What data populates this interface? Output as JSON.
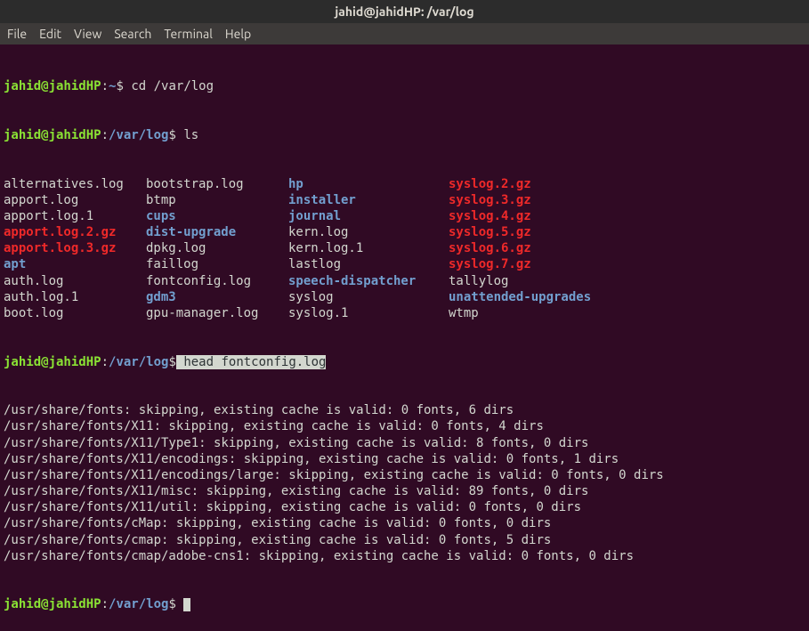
{
  "title_bar": "jahid@jahidHP: /var/log",
  "menu": {
    "file": "File",
    "edit": "Edit",
    "view": "View",
    "search": "Search",
    "terminal": "Terminal",
    "help": "Help"
  },
  "prompts": {
    "user_host": "jahid@jahidHP",
    "home_path": "~",
    "log_path": "/var/log",
    "dollar": "$"
  },
  "commands": {
    "cd": " cd /var/log",
    "ls": " ls",
    "head": " head fontconfig.log"
  },
  "ls": {
    "rows": [
      [
        {
          "t": "alternatives.log",
          "c": "white"
        },
        {
          "t": "bootstrap.log",
          "c": "white"
        },
        {
          "t": "hp",
          "c": "blue"
        },
        {
          "t": "syslog.2.gz",
          "c": "red"
        }
      ],
      [
        {
          "t": "apport.log",
          "c": "white"
        },
        {
          "t": "btmp",
          "c": "white"
        },
        {
          "t": "installer",
          "c": "blue"
        },
        {
          "t": "syslog.3.gz",
          "c": "red"
        }
      ],
      [
        {
          "t": "apport.log.1",
          "c": "white"
        },
        {
          "t": "cups",
          "c": "blue"
        },
        {
          "t": "journal",
          "c": "blue"
        },
        {
          "t": "syslog.4.gz",
          "c": "red"
        }
      ],
      [
        {
          "t": "apport.log.2.gz",
          "c": "red"
        },
        {
          "t": "dist-upgrade",
          "c": "blue"
        },
        {
          "t": "kern.log",
          "c": "white"
        },
        {
          "t": "syslog.5.gz",
          "c": "red"
        }
      ],
      [
        {
          "t": "apport.log.3.gz",
          "c": "red"
        },
        {
          "t": "dpkg.log",
          "c": "white"
        },
        {
          "t": "kern.log.1",
          "c": "white"
        },
        {
          "t": "syslog.6.gz",
          "c": "red"
        }
      ],
      [
        {
          "t": "apt",
          "c": "blue"
        },
        {
          "t": "faillog",
          "c": "white"
        },
        {
          "t": "lastlog",
          "c": "white"
        },
        {
          "t": "syslog.7.gz",
          "c": "red"
        }
      ],
      [
        {
          "t": "auth.log",
          "c": "white"
        },
        {
          "t": "fontconfig.log",
          "c": "white"
        },
        {
          "t": "speech-dispatcher",
          "c": "blue"
        },
        {
          "t": "tallylog",
          "c": "white"
        }
      ],
      [
        {
          "t": "auth.log.1",
          "c": "white"
        },
        {
          "t": "gdm3",
          "c": "blue"
        },
        {
          "t": "syslog",
          "c": "white"
        },
        {
          "t": "unattended-upgrades",
          "c": "blue"
        }
      ],
      [
        {
          "t": "boot.log",
          "c": "white"
        },
        {
          "t": "gpu-manager.log",
          "c": "white"
        },
        {
          "t": "syslog.1",
          "c": "white"
        },
        {
          "t": "wtmp",
          "c": "white"
        }
      ]
    ]
  },
  "head_output": [
    "/usr/share/fonts: skipping, existing cache is valid: 0 fonts, 6 dirs",
    "/usr/share/fonts/X11: skipping, existing cache is valid: 0 fonts, 4 dirs",
    "/usr/share/fonts/X11/Type1: skipping, existing cache is valid: 8 fonts, 0 dirs",
    "/usr/share/fonts/X11/encodings: skipping, existing cache is valid: 0 fonts, 1 dirs",
    "/usr/share/fonts/X11/encodings/large: skipping, existing cache is valid: 0 fonts, 0 dirs",
    "/usr/share/fonts/X11/misc: skipping, existing cache is valid: 89 fonts, 0 dirs",
    "/usr/share/fonts/X11/util: skipping, existing cache is valid: 0 fonts, 0 dirs",
    "/usr/share/fonts/cMap: skipping, existing cache is valid: 0 fonts, 0 dirs",
    "/usr/share/fonts/cmap: skipping, existing cache is valid: 0 fonts, 5 dirs",
    "/usr/share/fonts/cmap/adobe-cns1: skipping, existing cache is valid: 0 fonts, 0 dirs"
  ]
}
